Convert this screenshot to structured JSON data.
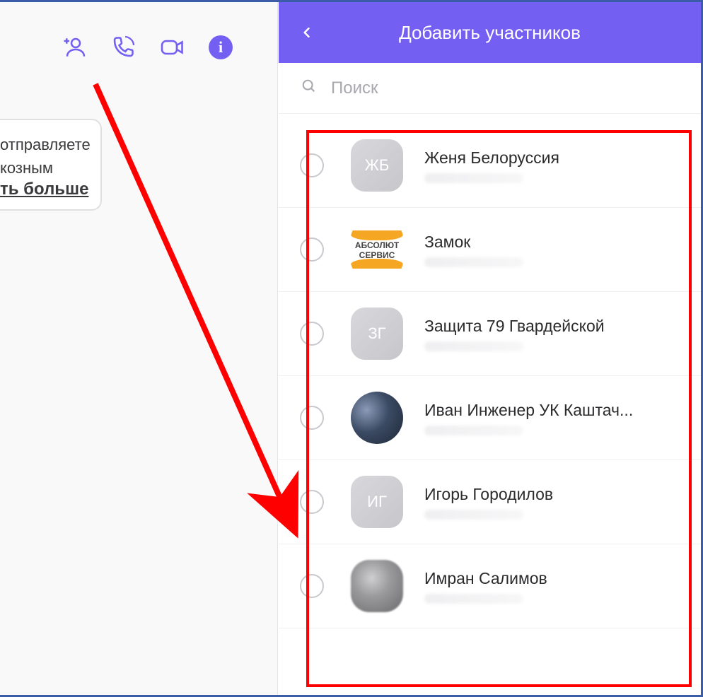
{
  "colors": {
    "accent": "#7360f2",
    "highlight": "#ff0000",
    "border": "#3b5da8"
  },
  "left": {
    "chat_line1": "отправляете",
    "chat_line2": "козным",
    "chat_link": "ть больше"
  },
  "header": {
    "title": "Добавить участников"
  },
  "search": {
    "placeholder": "Поиск"
  },
  "contacts": [
    {
      "name": "Женя Белоруссия",
      "initials": "ЖБ",
      "avatar_type": "initials"
    },
    {
      "name": "Замок",
      "avatar_type": "logo",
      "logo_text1": "АБСОЛЮТ",
      "logo_text2": "СЕРВИС"
    },
    {
      "name": "Защита 79 Гвардейской",
      "initials": "ЗГ",
      "avatar_type": "initials"
    },
    {
      "name": "Иван Инженер УК Каштач...",
      "avatar_type": "photo"
    },
    {
      "name": "Игорь Городилов",
      "initials": "ИГ",
      "avatar_type": "initials"
    },
    {
      "name": "Имран Салимов",
      "avatar_type": "photo2"
    }
  ]
}
